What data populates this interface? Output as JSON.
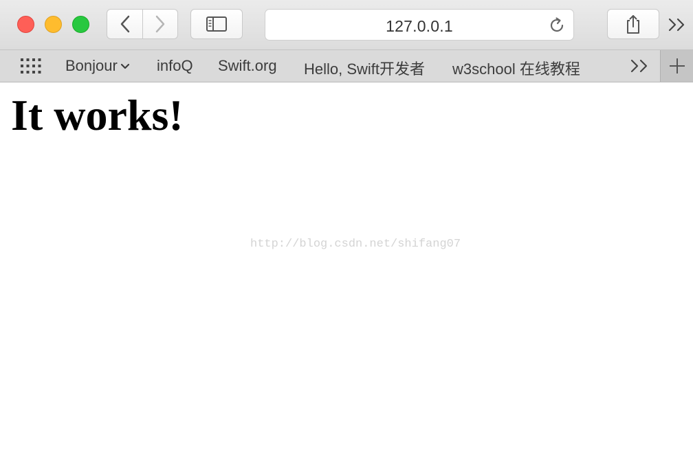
{
  "toolbar": {
    "url": "127.0.0.1",
    "icons": {
      "back": "chevron-left-icon",
      "forward": "chevron-right-icon",
      "sidebar": "sidebar-icon",
      "reload": "reload-icon",
      "share": "share-icon",
      "overflow": "double-chevron-right-icon"
    }
  },
  "bookmarks": {
    "items": [
      {
        "label": "Bonjour",
        "has_menu": true
      },
      {
        "label": "infoQ"
      },
      {
        "label": "Swift.org"
      },
      {
        "label": "Hello, Swift开发者"
      },
      {
        "label": "w3school 在线教程"
      }
    ],
    "more_label": ">>",
    "new_tab_label": "+"
  },
  "page": {
    "heading": "It works!",
    "watermark": "http://blog.csdn.net/shifang07"
  },
  "colors": {
    "close": "#fe5f57",
    "minimize": "#febc2e",
    "maximize": "#28c840",
    "toolbar_bg": "#dcdcdc",
    "bookmarks_bg": "#dadada",
    "content_bg": "#ffffff"
  }
}
